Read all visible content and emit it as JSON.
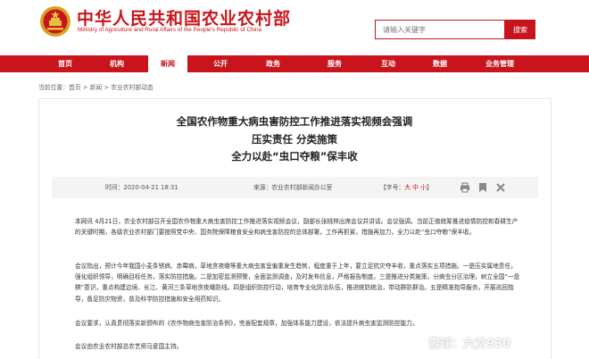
{
  "header": {
    "site_title": "中华人民共和国农业农村部",
    "site_subtitle": "Ministry of Agriculture and Rural Affairs of the People's Republic of China",
    "search_placeholder": "请输入关键字",
    "search_button": "搜索"
  },
  "nav": {
    "items": [
      "首页",
      "机构",
      "新闻",
      "公开",
      "政务",
      "服务",
      "互动",
      "数据",
      "业务管理"
    ],
    "active": "新闻"
  },
  "breadcrumb": "当前位置：首页 > 新闻 > 农业农村部动态",
  "article": {
    "title_lines": [
      "全国农作物重大病虫害防控工作推进落实视频会强调",
      "压实责任 分类施策",
      "全力以赴“虫口夺粮”保丰收"
    ],
    "date": "时间：2020-04-21 18:31",
    "source": "来源：农业农村部新闻办公室",
    "font_label_prefix": "【字号：",
    "font_big": "大",
    "font_mid": "中",
    "font_small": "小",
    "font_label_suffix": "】",
    "paragraphs": [
      "本网讯 4月21日，农业农村部召开全国农作物重大病虫害防控工作推进落实视频会议，副部长张桃林出席会议并讲话。会议强调，当前正值统筹推进疫情防控和春耕生产的关键时期，各级农业农村部门要按照党中央、国务院保障粮食安全和病虫害防控的总体部署，工作再抓紧，措施再加力，全力以赴“虫口夺粮”保丰收。",
      "会议指出，预计今年我国小麦条锈病、赤霉病，草地贪夜蛾等重大病虫害呈偏重发生趋势，程度重于上年，要立足抗灾夺丰收，重点落实五项措施。一是压实属地责任，强化组织领导，明确目标任务，落实防控措施。二是加密监测预警，全面监测调查，及时发布信息，严格报告制度。三是推进分类施策，分病虫分区治理，树立全国“一盘棋”意识，重点构建边境、长江、黄河三条草地贪夜蛾防线。四是组织防控行动，培育专业化防治队伍，推进统防统治，带动群防群治。五是精准指导服务，开展巡回指导，备足防灾物资，普及科学防控措施和安全用药知识。",
      "会议要求，认真贯彻落实新颁布的《农作物病虫害防治条例》，完善配套规章，加强体系能力建设，依法提升病虫害监测防控能力。",
      "会议由农业农村部总农艺师马爱国主持。"
    ]
  },
  "watermark": "雪球：六爻930",
  "colors": {
    "brand_red": "#c8151d",
    "meta_bg": "#f4f4f4"
  }
}
